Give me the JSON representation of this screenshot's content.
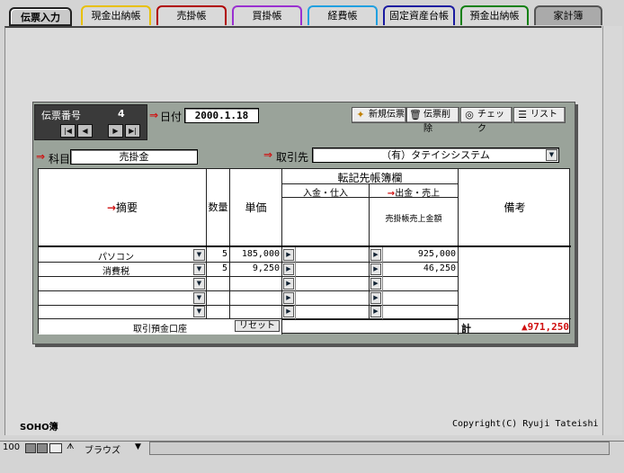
{
  "tabs": [
    {
      "label": "伝票入力",
      "color": "#222222",
      "active": true
    },
    {
      "label": "現金出納帳",
      "color": "#e8c000"
    },
    {
      "label": "売掛帳",
      "color": "#b00000"
    },
    {
      "label": "買掛帳",
      "color": "#9a30d0"
    },
    {
      "label": "経費帳",
      "color": "#20a0e0"
    },
    {
      "label": "固定資産台帳",
      "color": "#1a1aa0"
    },
    {
      "label": "預金出納帳",
      "color": "#108010"
    },
    {
      "label": "家計簿",
      "color": "#666666"
    }
  ],
  "slip": {
    "label": "伝票番号",
    "number": "4"
  },
  "date": {
    "label": "日付",
    "value": "2000.1.18"
  },
  "toolbar": {
    "new": "新規伝票",
    "delete": "伝票削除",
    "check": "チェック",
    "list": "リスト"
  },
  "subject": {
    "label": "科目",
    "value": "売掛金"
  },
  "partner": {
    "label": "取引先",
    "value": "（有）タテイシシステム"
  },
  "table": {
    "h_summary": "摘要",
    "h_qty": "数量",
    "h_price": "単価",
    "h_ledger": "転記先帳簿欄",
    "h_in": "入金・仕入",
    "h_out": "出金・売上",
    "h_sales_amount": "売掛帳売上金額",
    "h_note": "備考",
    "rows": [
      {
        "item": "パソコン",
        "qty": "5",
        "price": "185,000",
        "amount": "925,000"
      },
      {
        "item": "消費税",
        "qty": "5",
        "price": "9,250",
        "amount": "46,250"
      },
      {
        "item": "",
        "qty": "",
        "price": "",
        "amount": ""
      },
      {
        "item": "",
        "qty": "",
        "price": "",
        "amount": ""
      },
      {
        "item": "",
        "qty": "",
        "price": "",
        "amount": ""
      }
    ],
    "bank_label": "取引預金口座",
    "reset": "リセット",
    "total_label": "計",
    "total_value": "▲971,250"
  },
  "footer": {
    "left": "SOHO簿",
    "right": "Copyright(C) Ryuji Tateishi"
  },
  "status": {
    "zoom": "100",
    "mode": "ブラウズ"
  },
  "colors": {
    "panel": "#9aa39a",
    "accent": "#d01010"
  }
}
